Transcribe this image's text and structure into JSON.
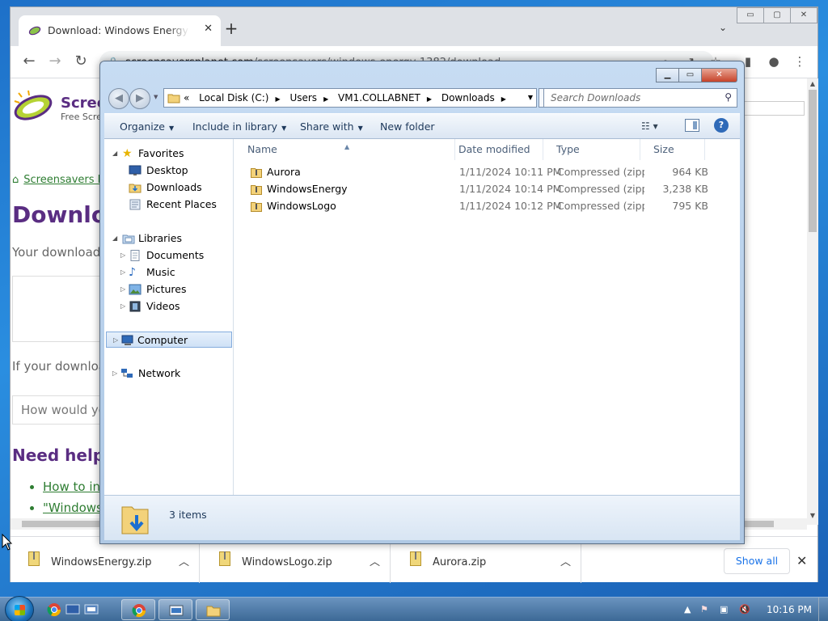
{
  "browser": {
    "tab_title": "Download: Windows Energy - Sc",
    "tab_close": "✕",
    "new_tab": "+",
    "url_host": "screensaversplanet.com",
    "url_path": "/screensavers/windows-energy-1382/download",
    "window_controls": [
      "▭",
      "▢",
      "✕"
    ]
  },
  "page": {
    "brand": "Scree",
    "brand_sub": "Free Scre",
    "breadcrumb": "Screensavers P",
    "heading": "Downlo",
    "download_text": "Your download",
    "if_text": "If your downloa",
    "question_placeholder": "How would yo",
    "help_heading": "Need help",
    "links": [
      "How to in",
      "\"Windows"
    ]
  },
  "downloads_bar": {
    "items": [
      {
        "name": "WindowsEnergy.zip"
      },
      {
        "name": "WindowsLogo.zip"
      },
      {
        "name": "Aurora.zip"
      }
    ],
    "show_all": "Show all",
    "close": "✕"
  },
  "explorer": {
    "address": [
      "Local Disk (C:)",
      "Users",
      "VM1.COLLABNET",
      "Downloads"
    ],
    "address_prefix": "«",
    "search_placeholder": "Search Downloads",
    "commands": {
      "organize": "Organize",
      "include": "Include in library",
      "share": "Share with",
      "new_folder": "New folder"
    },
    "help": "?",
    "nav": {
      "favorites": "Favorites",
      "desktop": "Desktop",
      "downloads": "Downloads",
      "recent": "Recent Places",
      "libraries": "Libraries",
      "documents": "Documents",
      "music": "Music",
      "pictures": "Pictures",
      "videos": "Videos",
      "computer": "Computer",
      "network": "Network"
    },
    "columns": {
      "name": "Name",
      "date": "Date modified",
      "type": "Type",
      "size": "Size"
    },
    "files": [
      {
        "name": "Aurora",
        "date": "1/11/2024 10:11 PM",
        "type": "Compressed (zipp...",
        "size": "964 KB"
      },
      {
        "name": "WindowsEnergy",
        "date": "1/11/2024 10:14 PM",
        "type": "Compressed (zipp...",
        "size": "3,238 KB"
      },
      {
        "name": "WindowsLogo",
        "date": "1/11/2024 10:12 PM",
        "type": "Compressed (zipp...",
        "size": "795 KB"
      }
    ],
    "item_count": "3 items"
  },
  "taskbar": {
    "clock": "10:16 PM"
  },
  "colors": {
    "brand_purple": "#5a2d82",
    "link_green": "#2e7d32",
    "explorer_frame": "#b6cfea",
    "taskbar": "#3c6996"
  }
}
